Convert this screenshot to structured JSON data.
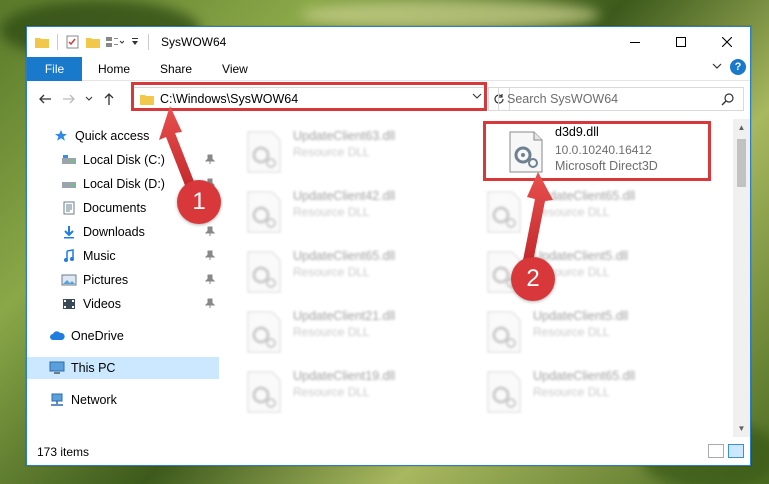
{
  "window": {
    "title": "SysWOW64"
  },
  "ribbon": {
    "tabs": [
      "File",
      "Home",
      "Share",
      "View"
    ],
    "help_label": "?"
  },
  "navbar": {
    "address": "C:\\Windows\\SysWOW64",
    "search_placeholder": "Search SysWOW64"
  },
  "sidebar": {
    "items": [
      {
        "label": "Quick access",
        "icon": "star-icon",
        "pinned": false
      },
      {
        "label": "Local Disk (C:)",
        "icon": "drive-icon",
        "pinned": true
      },
      {
        "label": "Local Disk (D:)",
        "icon": "drive-icon",
        "pinned": true
      },
      {
        "label": "Documents",
        "icon": "documents-icon",
        "pinned": true
      },
      {
        "label": "Downloads",
        "icon": "download-icon",
        "pinned": true
      },
      {
        "label": "Music",
        "icon": "music-icon",
        "pinned": true
      },
      {
        "label": "Pictures",
        "icon": "pictures-icon",
        "pinned": true
      },
      {
        "label": "Videos",
        "icon": "videos-icon",
        "pinned": true
      },
      {
        "label": "OneDrive",
        "icon": "cloud-icon",
        "pinned": false
      },
      {
        "label": "This PC",
        "icon": "computer-icon",
        "pinned": false,
        "selected": true
      },
      {
        "label": "Network",
        "icon": "network-icon",
        "pinned": false
      }
    ]
  },
  "files": {
    "left": [
      {
        "name": "UpdateClient63.dll",
        "type": "Resource DLL"
      },
      {
        "name": "UpdateClient42.dll",
        "type": "Resource DLL"
      },
      {
        "name": "UpdateClient65.dll",
        "type": "Resource DLL"
      },
      {
        "name": "UpdateClient21.dll",
        "type": "Resource DLL"
      },
      {
        "name": "UpdateClient19.dll",
        "type": "Resource DLL"
      }
    ],
    "right": [
      {
        "name": "d3d9.dll",
        "version": "10.0.10240.16412",
        "type": "Microsoft Direct3D",
        "highlighted": true
      },
      {
        "name": "UpdateClient65.dll",
        "type": "Resource DLL"
      },
      {
        "name": "UpdateClient5.dll",
        "type": "Resource DLL"
      },
      {
        "name": "UpdateClient5.dll",
        "type": "Resource DLL"
      },
      {
        "name": "UpdateClient65.dll",
        "type": "Resource DLL"
      }
    ]
  },
  "status": {
    "item_count": "173 items"
  },
  "annotations": {
    "badge1": "1",
    "badge2": "2"
  },
  "colors": {
    "accent": "#1979ca",
    "highlight": "#d9383a",
    "selected": "#cce8ff"
  }
}
